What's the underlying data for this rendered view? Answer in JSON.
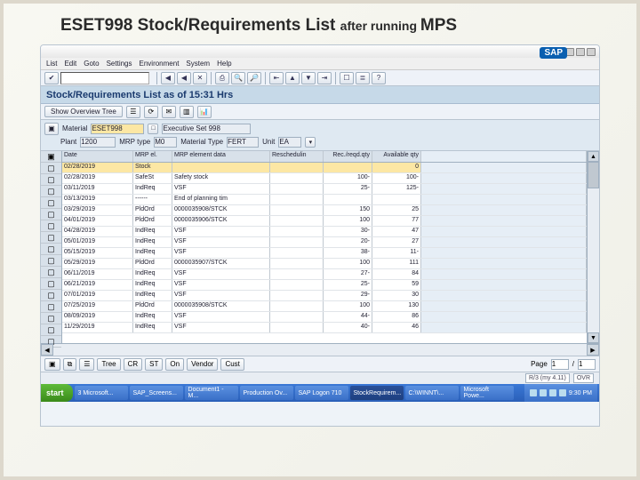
{
  "slide": {
    "title_big": "ESET998 Stock/Requirements List ",
    "title_small": "after running ",
    "title_big2": "MPS"
  },
  "win": {
    "ctrl_min": "r",
    "ctrl_max": "r",
    "ctrl_close": "r"
  },
  "menubar": [
    "List",
    "Edit",
    "Goto",
    "Settings",
    "Environment",
    "System",
    "Help"
  ],
  "stdbar": {
    "back": "◀",
    "exit": "◀",
    "cancel": "✕",
    "print": "⎙",
    "find": "🔍",
    "findn": "🔎",
    "first": "⇤",
    "prev": "▲",
    "next": "▼",
    "last": "⇥",
    "new": "☐",
    "layout": "≣",
    "help": "?",
    "check": "✔"
  },
  "heading": "Stock/Requirements List as of 15:31 Hrs",
  "apptool": {
    "show_tree": "Show Overview Tree",
    "i1": "☰",
    "i2": "⟳",
    "i3": "✉",
    "i4": "▥",
    "i5": "📊"
  },
  "sel": {
    "material_lbl": "Material",
    "material_val": "ESET998",
    "desc_lbl": "",
    "desc_val": "Executive Set 998",
    "plant_lbl": "Plant",
    "plant_val": "1200",
    "mrp_type_lbl": "MRP type",
    "mrp_type_val": "M0",
    "mat_type_lbl": "Material Type",
    "mat_type_val": "FERT",
    "unit_lbl": "Unit",
    "unit_val": "EA",
    "z_lbl": ""
  },
  "grid": {
    "headers": {
      "date": "Date",
      "mrp_el": "MRP el.",
      "data": "MRP element data",
      "resch": "Reschedulin",
      "rec": "Rec./reqd.qty",
      "avail": "Available qty"
    },
    "rows": [
      {
        "date": "02/28/2019",
        "el": "Stock",
        "data": "",
        "resch": "",
        "rec": "",
        "avail": "0",
        "yellow": true
      },
      {
        "date": "02/28/2019",
        "el": "SafeSt",
        "data": "Safety stock",
        "resch": "",
        "rec": "100-",
        "avail": "100-"
      },
      {
        "date": "03/11/2019",
        "el": "IndReq",
        "data": "VSF",
        "resch": "",
        "rec": "25-",
        "avail": "125-"
      },
      {
        "date": "03/13/2019",
        "el": "------",
        "data": "End of planning tim",
        "resch": "",
        "rec": "",
        "avail": ""
      },
      {
        "date": "03/29/2019",
        "el": "PldOrd",
        "data": "0000035908/STCK",
        "resch": "",
        "rec": "150",
        "avail": "25"
      },
      {
        "date": "04/01/2019",
        "el": "PldOrd",
        "data": "0000035906/STCK",
        "resch": "",
        "rec": "100",
        "avail": "77"
      },
      {
        "date": "04/28/2019",
        "el": "IndReq",
        "data": "VSF",
        "resch": "",
        "rec": "30-",
        "avail": "47"
      },
      {
        "date": "05/01/2019",
        "el": "IndReq",
        "data": "VSF",
        "resch": "",
        "rec": "20-",
        "avail": "27"
      },
      {
        "date": "05/15/2019",
        "el": "IndReq",
        "data": "VSF",
        "resch": "",
        "rec": "38-",
        "avail": "11-"
      },
      {
        "date": "05/29/2019",
        "el": "PldOrd",
        "data": "0000035907/STCK",
        "resch": "",
        "rec": "100",
        "avail": "111"
      },
      {
        "date": "06/11/2019",
        "el": "IndReq",
        "data": "VSF",
        "resch": "",
        "rec": "27-",
        "avail": "84"
      },
      {
        "date": "06/21/2019",
        "el": "IndReq",
        "data": "VSF",
        "resch": "",
        "rec": "25-",
        "avail": "59"
      },
      {
        "date": "07/01/2019",
        "el": "IndReq",
        "data": "VSF",
        "resch": "",
        "rec": "29-",
        "avail": "30"
      },
      {
        "date": "07/25/2019",
        "el": "PldOrd",
        "data": "0000035908/STCK",
        "resch": "",
        "rec": "100",
        "avail": "130"
      },
      {
        "date": "08/09/2019",
        "el": "IndReq",
        "data": "VSF",
        "resch": "",
        "rec": "44-",
        "avail": "86"
      },
      {
        "date": "11/29/2019",
        "el": "IndReq",
        "data": "VSF",
        "resch": "",
        "rec": "40-",
        "avail": "46"
      }
    ]
  },
  "gridfooter": {
    "btns": [
      "▣",
      "⧉",
      "☰",
      "Tree",
      "CR",
      "ST",
      "On",
      "Vendor",
      "Cust"
    ],
    "page_lbl": "Page",
    "page_cur": "1",
    "page_sep": "/",
    "page_tot": "1"
  },
  "status": {
    "sys": "R/3 (my 4.11)",
    "ovr": "OVR"
  },
  "taskbar": {
    "start": "start",
    "items": [
      "3 Microsoft...",
      "SAP_Screens...",
      "Document1 - M...",
      "Production Ov...",
      "SAP Logon 710",
      "StockRequirem...",
      "C:\\WINNT\\...",
      "Microsoft Powe..."
    ],
    "active_index": 5,
    "clock": "9:30 PM"
  }
}
